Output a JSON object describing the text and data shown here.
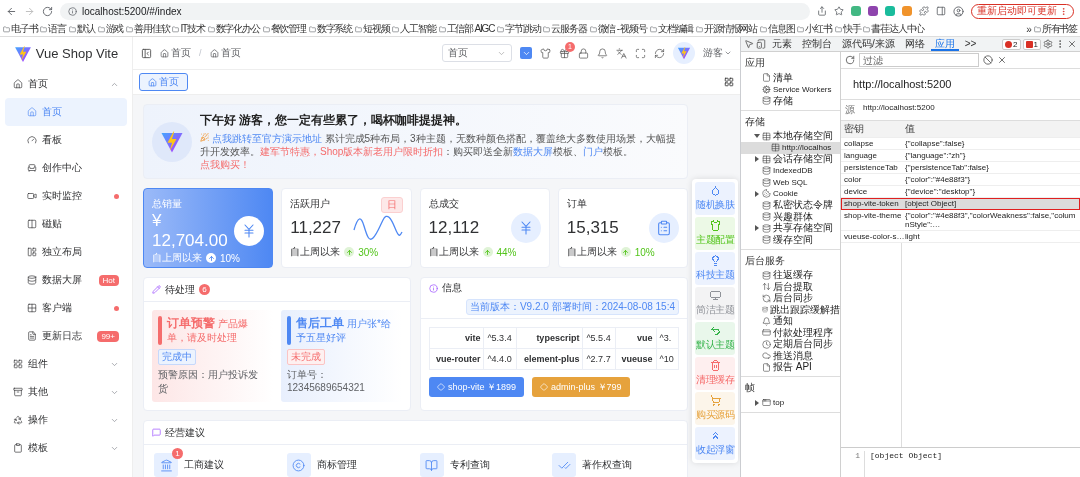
{
  "browser": {
    "url": "localhost:5200/#/index",
    "update_button": "重新启动即可更新",
    "bookmarks": [
      "电子书",
      "语言",
      "默认",
      "游戏",
      "善用佳软",
      "IT技术",
      "数字化办公",
      "餐饮管理",
      "数字系统",
      "短视频",
      "人工智能",
      "工信部 AIGC",
      "字节跳动",
      "云服务器",
      "微信 - 视频号",
      "文档编辑",
      "开源情报网站",
      "信息图",
      "小红书",
      "快手",
      "書荏达人中心"
    ],
    "more": "»",
    "all_bookmarks": "所有书签"
  },
  "sidebar": {
    "logo": "Vue Shop Vite",
    "items": [
      {
        "label": "首页",
        "expanded": true,
        "children": [
          {
            "label": "首页",
            "selected": true,
            "dot": false
          },
          {
            "label": "看板",
            "selected": false,
            "dot": false
          },
          {
            "label": "创作中心",
            "selected": false,
            "dot": false
          },
          {
            "label": "实时监控",
            "selected": false,
            "dot": true
          },
          {
            "label": "磁贴",
            "selected": false,
            "dot": false
          },
          {
            "label": "独立布局",
            "selected": false,
            "dot": false
          },
          {
            "label": "数据大屏",
            "selected": false,
            "dot": false,
            "badge": "Hot"
          },
          {
            "label": "客户端",
            "selected": false,
            "dot": true
          },
          {
            "label": "更新日志",
            "selected": false,
            "dot": false,
            "badge": "99+"
          }
        ]
      },
      {
        "label": "组件",
        "expanded": false
      },
      {
        "label": "其他",
        "expanded": false
      },
      {
        "label": "操作",
        "expanded": false
      },
      {
        "label": "模板",
        "expanded": false
      }
    ]
  },
  "header": {
    "breadcrumb": [
      "首页",
      "首页"
    ],
    "breadcrumb_separator": "/",
    "menu_select": "首页",
    "notification_count": "1",
    "user": "游客"
  },
  "tabs": [
    {
      "label": "首页",
      "selected": true
    }
  ],
  "welcome": {
    "title": "下午好 游客，您一定有些累了，喝杯咖啡提提神。",
    "segments": [
      {
        "kind": "link",
        "text": "点我跳转至官方演示地址"
      },
      {
        "kind": "text",
        "text": " 累计完成5种布局，3种主题，无数种颜色搭配，覆盖绝大多数使用场景，大幅提升开发效率。"
      },
      {
        "kind": "promo",
        "text": "建军节特惠，Shop版本新老用户限时折扣"
      },
      {
        "kind": "text",
        "text": "：购买即送全新"
      },
      {
        "kind": "link",
        "text": "数据大屏"
      },
      {
        "kind": "text",
        "text": "模板、"
      },
      {
        "kind": "link",
        "text": "门户"
      },
      {
        "kind": "text",
        "text": "模板。"
      },
      {
        "kind": "buy",
        "text": "点我购买！"
      }
    ]
  },
  "stats": [
    {
      "kind": "highlight",
      "title": "总销量",
      "value": "¥ 12,704.00",
      "footer": "自上周以来",
      "change": "10%"
    },
    {
      "kind": "chart",
      "title": "活跃用户",
      "value": "11,227",
      "tag": "日",
      "footer": "自上周以来",
      "change": "30%"
    },
    {
      "kind": "icon",
      "title": "总成交",
      "value": "12,112",
      "footer": "自上周以来",
      "change": "44%"
    },
    {
      "kind": "icon",
      "title": "订单",
      "value": "15,315",
      "footer": "自上周以来",
      "change": "10%"
    }
  ],
  "pending": {
    "title": "待处理",
    "count": "6",
    "items": [
      {
        "kind": "warning",
        "title": "订单预警",
        "desc": "产品爆单，请及时处理",
        "status": "完成中",
        "note": "预警原因：用户投诉发货"
      },
      {
        "kind": "service",
        "title": "售后工单",
        "desc": "用户张*给予五星好评",
        "status": "未完成",
        "note": "订单号：12345689654321"
      }
    ]
  },
  "info": {
    "title": "信息",
    "version": "当前版本：V9.2.0 部署时间：2024-08-08 15:4",
    "rows": [
      [
        "vite",
        "^5.3.4",
        "typescript",
        "^5.5.4",
        "vue",
        "^3."
      ],
      [
        "vue-router",
        "^4.4.0",
        "element-plus",
        "^2.7.7",
        "vueuse",
        "^10"
      ]
    ],
    "buttons": [
      {
        "kind": "primary",
        "label": "shop-vite ￥1899"
      },
      {
        "kind": "warning",
        "label": "admin-plus ￥799"
      }
    ]
  },
  "advice": {
    "title": "经营建议",
    "items": [
      {
        "label": "工商建议",
        "badge": "1"
      },
      {
        "label": "商标管理"
      },
      {
        "label": "专利查询"
      },
      {
        "label": "著作权查询"
      }
    ]
  },
  "float_panel": [
    {
      "label": "随机换肤",
      "color": "#4e88f3"
    },
    {
      "label": "主题配置",
      "color": "#52c41a"
    },
    {
      "label": "科技主题",
      "color": "#4e88f3"
    },
    {
      "label": "简洁主题",
      "color": "#909399"
    },
    {
      "label": "默认主题",
      "color": "#35b34a"
    },
    {
      "label": "清理缓存",
      "color": "#f56c6c"
    },
    {
      "label": "购买源码",
      "color": "#e6a23c"
    },
    {
      "label": "收起浮窗",
      "color": "#4e88f3"
    }
  ],
  "devtools": {
    "tabs": [
      {
        "label": "元素",
        "selected": false
      },
      {
        "label": "控制台",
        "selected": false
      },
      {
        "label": "源代码/来源",
        "selected": false
      },
      {
        "label": "网络",
        "selected": false
      },
      {
        "label": "应用",
        "selected": true
      }
    ],
    "more_tabs": ">>",
    "errors": "2",
    "warnings": "1",
    "sections": [
      {
        "title": "应用",
        "items": [
          {
            "label": "清单",
            "selected": false
          },
          {
            "label": "Service Workers",
            "selected": false
          },
          {
            "label": "存储",
            "selected": false
          }
        ]
      },
      {
        "title": "存储",
        "items": [
          {
            "label": "本地存储空间",
            "selected": false,
            "expanded": true,
            "children": [
              {
                "label": "http://localhos",
                "selected": true
              }
            ]
          },
          {
            "label": "会话存储空间",
            "selected": false,
            "expanded": false
          },
          {
            "label": "IndexedDB",
            "selected": false
          },
          {
            "label": "Web SQL",
            "selected": false
          },
          {
            "label": "Cookie",
            "selected": false,
            "expanded": false
          },
          {
            "label": "私密状态令牌",
            "selected": false
          },
          {
            "label": "兴趣群体",
            "selected": false
          },
          {
            "label": "共享存储空间",
            "selected": false,
            "expanded": false
          },
          {
            "label": "缓存空间",
            "selected": false
          }
        ]
      },
      {
        "title": "后台服务",
        "items": [
          {
            "label": "往返缓存",
            "selected": false
          },
          {
            "label": "后台提取",
            "selected": false
          },
          {
            "label": "后台同步",
            "selected": false
          },
          {
            "label": "跳出跟踪缓解措",
            "selected": false
          },
          {
            "label": "通知",
            "selected": false
          },
          {
            "label": "付款处理程序",
            "selected": false
          },
          {
            "label": "定期后台同步",
            "selected": false
          },
          {
            "label": "推送消息",
            "selected": false
          },
          {
            "label": "报告 API",
            "selected": false
          }
        ]
      },
      {
        "title": "帧",
        "items": [
          {
            "label": "top",
            "selected": false,
            "expanded": false
          }
        ]
      }
    ],
    "filter_placeholder": "过滤",
    "heading": "http://localhost:5200",
    "origin_label": "源",
    "origin_value": "http://localhost:5200",
    "columns": [
      "密钥",
      "值"
    ],
    "rows": [
      {
        "key": "collapse",
        "value": "{\"collapse\":false}",
        "selected": false,
        "annotated": false
      },
      {
        "key": "language",
        "value": "{\"language\":\"zh\"}",
        "selected": false,
        "annotated": false
      },
      {
        "key": "persistenceTab",
        "value": "{\"persistenceTab\":false}",
        "selected": false,
        "annotated": false
      },
      {
        "key": "color",
        "value": "{\"color\":\"#4e88f3\"}",
        "selected": false,
        "annotated": false
      },
      {
        "key": "device",
        "value": "{\"device\":\"desktop\"}",
        "selected": false,
        "annotated": false
      },
      {
        "key": "shop-vite-token",
        "value": "[object Object]",
        "selected": true,
        "annotated": true
      },
      {
        "key": "shop-vite-theme",
        "value": "{\"color\":\"#4e88f3\",\"colorWeakness\":false,\"columnStyle\":…",
        "selected": false,
        "annotated": false
      },
      {
        "key": "vueuse-color-s…",
        "value": "light",
        "selected": false,
        "annotated": false
      }
    ],
    "preview": {
      "line": "1",
      "text": "[object Object]"
    }
  }
}
